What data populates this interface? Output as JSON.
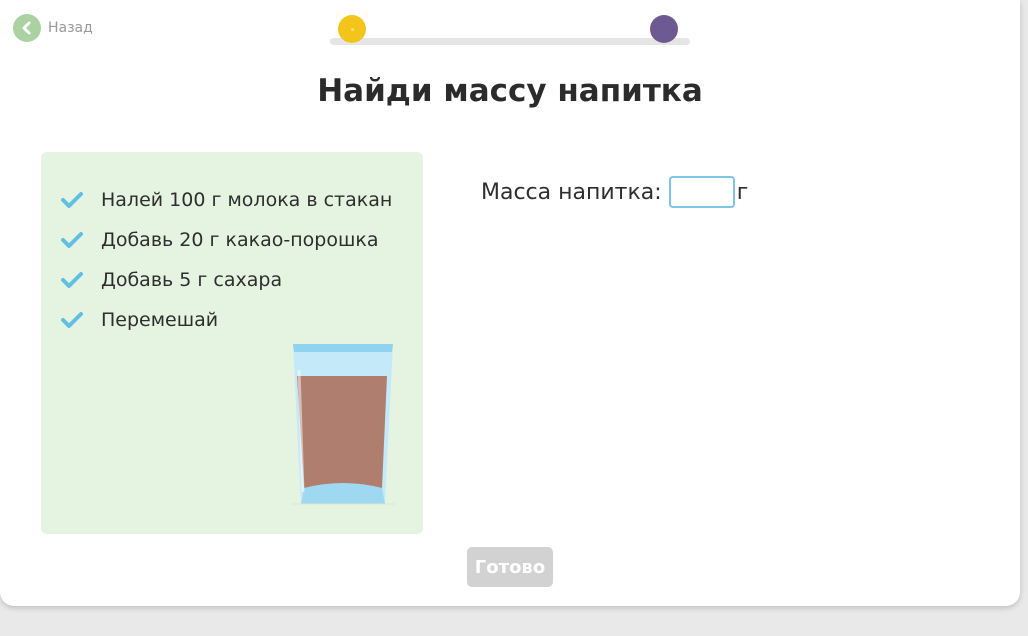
{
  "nav": {
    "back_label": "Назад"
  },
  "progress": {
    "current_step": 1,
    "total_steps": 2
  },
  "title": "Найди массу напитка",
  "steps": [
    {
      "text": "Налей 100 г молока в стакан",
      "done": true
    },
    {
      "text": "Добавь 20 г какао-порошка",
      "done": true
    },
    {
      "text": "Добавь 5 г сахара",
      "done": true
    },
    {
      "text": "Перемешай",
      "done": true
    }
  ],
  "answer": {
    "label": "Масса напитка:",
    "value": "",
    "unit": "г"
  },
  "done_button": {
    "label": "Готово",
    "enabled": false
  },
  "colors": {
    "panel_bg": "#e5f4e1",
    "check": "#5fc0e4",
    "progress_start": "#f3c51a",
    "progress_end": "#6d5a93",
    "drink": "#b07e6e",
    "glass": "#a6dcf2"
  }
}
